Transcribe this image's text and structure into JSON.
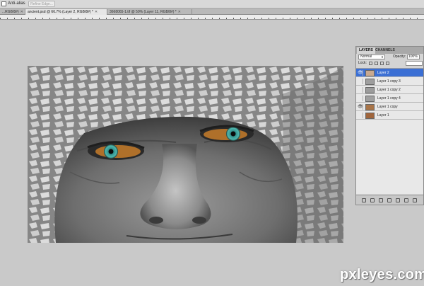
{
  "options_bar": {
    "anti_alias_label": "Anti-alias",
    "refine_edge_label": "Refine Edge..."
  },
  "tabs": [
    {
      "label": "...RGB/8#)",
      "active": false
    },
    {
      "label": "ancient.psd @ 66.7% (Layer 2, RGB/8#) *",
      "active": true
    },
    {
      "label": "3668065-1.tif @ 50% (Layer 11, RGB/8#) *",
      "active": false
    }
  ],
  "layers_panel": {
    "tabs": [
      "LAYERS",
      "CHANNELS"
    ],
    "blend_mode": "Normal",
    "opacity_label": "Opacity:",
    "opacity_value": "100%",
    "lock_label": "Lock:",
    "layers": [
      {
        "name": "Layer 2",
        "visible": true,
        "selected": true,
        "thumb_color": "#c9a98f"
      },
      {
        "name": "Layer 1 copy 3",
        "visible": false,
        "selected": false,
        "thumb_color": "#9e9e9e"
      },
      {
        "name": "Layer 1 copy 2",
        "visible": false,
        "selected": false,
        "thumb_color": "#9c9c9c"
      },
      {
        "name": "Layer 1 copy 4",
        "visible": false,
        "selected": false,
        "thumb_color": "#a0a0a0"
      },
      {
        "name": "Layer 1 copy",
        "visible": true,
        "selected": false,
        "thumb_color": "#a87448"
      },
      {
        "name": "Layer 1",
        "visible": false,
        "selected": false,
        "thumb_color": "#a0653c"
      }
    ]
  },
  "watermark": "pxleyes.com",
  "colors": {
    "canvas_bg": "#c9c9c9",
    "selection": "#3b6fd4",
    "iris": "#3fa7a0"
  }
}
